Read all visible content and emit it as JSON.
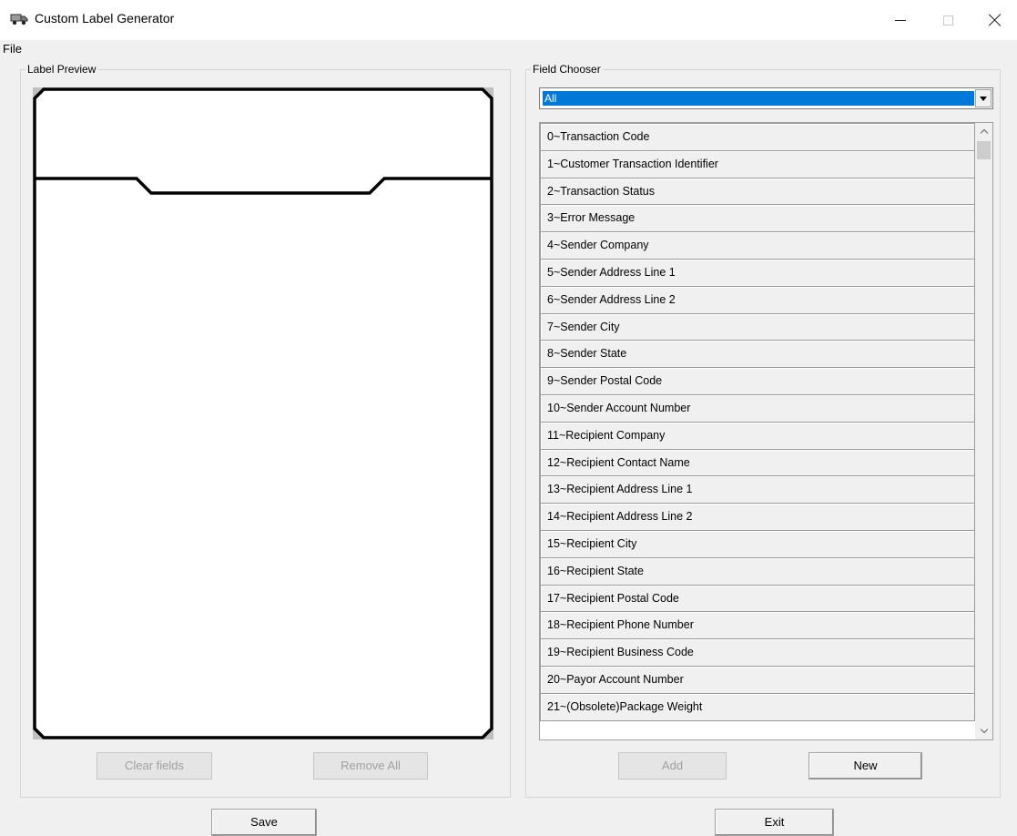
{
  "window": {
    "title": "Custom Label Generator",
    "icon": "truck-icon",
    "controls": [
      "minimize",
      "maximize",
      "close"
    ]
  },
  "menu": {
    "file": "File"
  },
  "preview": {
    "legend": "Label Preview",
    "clear_fields": "Clear fields",
    "remove_all": "Remove All"
  },
  "chooser": {
    "legend": "Field Chooser",
    "filter_value": "All",
    "fields": [
      "0~Transaction Code",
      "1~Customer Transaction Identifier",
      "2~Transaction Status",
      "3~Error Message",
      "4~Sender Company",
      "5~Sender Address Line 1",
      "6~Sender Address Line 2",
      "7~Sender City",
      "8~Sender State",
      "9~Sender Postal Code",
      "10~Sender Account Number",
      "11~Recipient Company",
      "12~Recipient Contact Name",
      "13~Recipient Address Line 1",
      "14~Recipient Address Line 2",
      "15~Recipient City",
      "16~Recipient State",
      "17~Recipient Postal Code",
      "18~Recipient Phone Number",
      "19~Recipient Business Code",
      "20~Payor Account Number",
      "21~(Obsolete)Package Weight"
    ],
    "add": "Add",
    "new": "New"
  },
  "footer": {
    "save": "Save",
    "exit": "Exit"
  },
  "colors": {
    "selection": "#0078d7",
    "window_bg": "#f0f0f0"
  }
}
